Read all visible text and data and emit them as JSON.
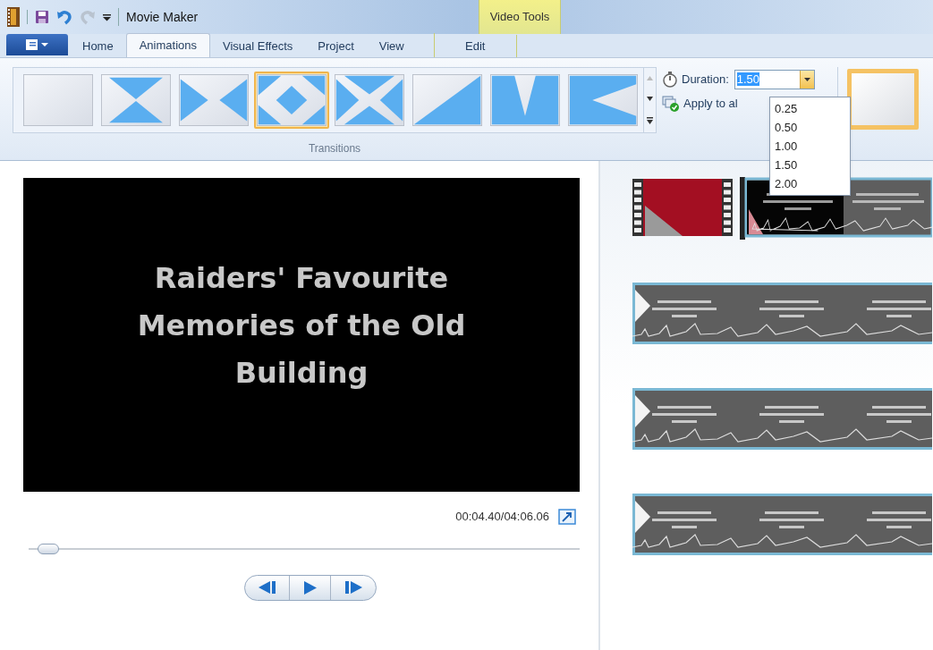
{
  "title_bar": {
    "app_title": "Movie Maker",
    "contextual_group": "Video Tools"
  },
  "tabs": [
    {
      "label": "Home",
      "selected": false
    },
    {
      "label": "Animations",
      "selected": true
    },
    {
      "label": "Visual Effects",
      "selected": false
    },
    {
      "label": "Project",
      "selected": false
    },
    {
      "label": "View",
      "selected": false
    },
    {
      "label": "Edit",
      "selected": false
    }
  ],
  "transitions": {
    "group_label": "Transitions",
    "items": [
      {
        "kind": "none",
        "selected": false
      },
      {
        "kind": "hourglass",
        "selected": false
      },
      {
        "kind": "bowtie",
        "selected": false
      },
      {
        "kind": "diamond",
        "selected": true
      },
      {
        "kind": "cross",
        "selected": false
      },
      {
        "kind": "diagonal",
        "selected": false
      },
      {
        "kind": "vee",
        "selected": false
      },
      {
        "kind": "wedge",
        "selected": false
      }
    ]
  },
  "duration": {
    "label": "Duration:",
    "value": "1.50",
    "options": [
      "0.25",
      "0.50",
      "1.00",
      "1.50",
      "2.00"
    ]
  },
  "apply_to_all": "Apply to al",
  "preview": {
    "title_lines": [
      "Raiders' Favourite",
      "Memories of the Old",
      "Building"
    ],
    "time": "00:04.40/04:06.06",
    "level": 0.02
  },
  "storyboard": [
    {
      "kind": "intro",
      "selected": true
    },
    {
      "kind": "title",
      "selected": false
    },
    {
      "kind": "title",
      "selected": false
    },
    {
      "kind": "title",
      "selected": false
    }
  ]
}
